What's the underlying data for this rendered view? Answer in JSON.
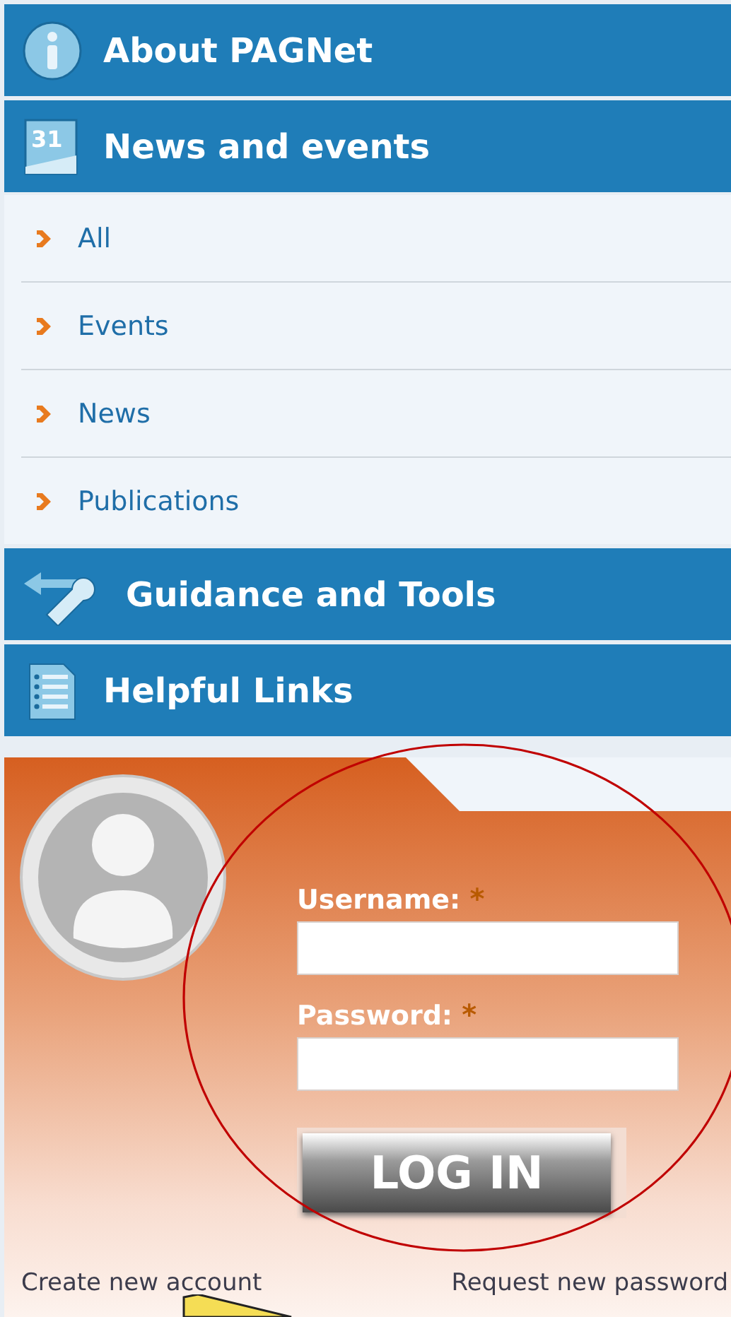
{
  "menu": [
    {
      "label": "About PAGNet"
    },
    {
      "label": "News and events",
      "icon_text": "31",
      "children": [
        {
          "label": "All"
        },
        {
          "label": "Events"
        },
        {
          "label": "News"
        },
        {
          "label": "Publications"
        }
      ]
    },
    {
      "label": "Guidance and Tools"
    },
    {
      "label": "Helpful Links"
    }
  ],
  "login": {
    "fields": [
      {
        "label": "Username:",
        "required_mark": "*"
      },
      {
        "label": "Password:",
        "required_mark": "*"
      }
    ],
    "button": "LOG IN",
    "links": [
      "Create new account",
      "Request new password"
    ]
  }
}
